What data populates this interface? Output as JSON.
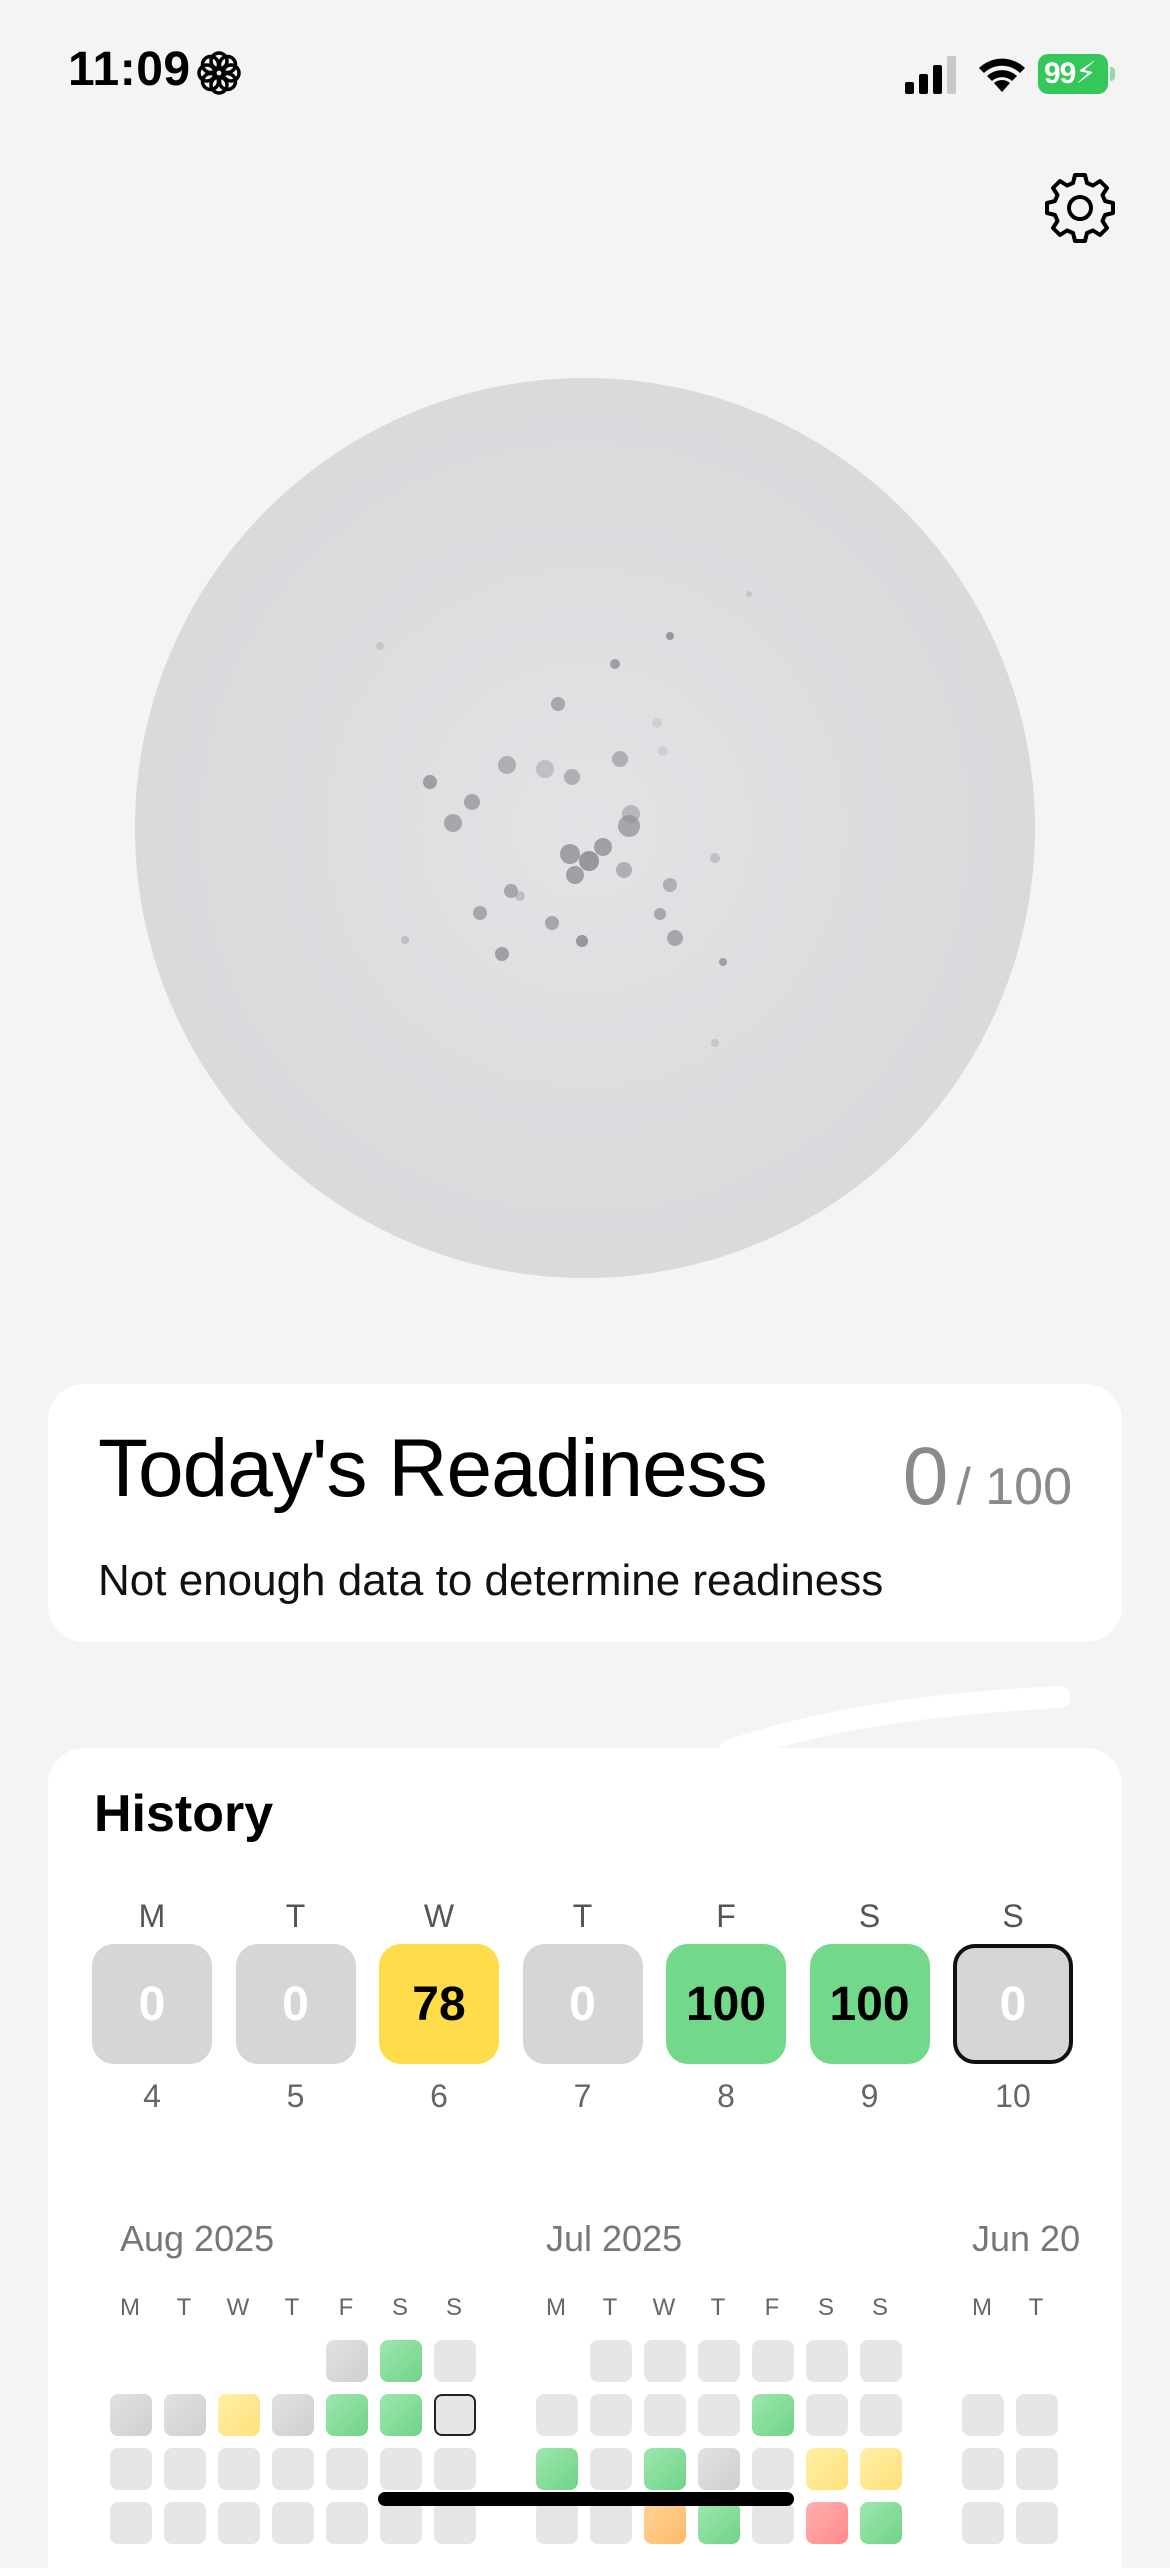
{
  "status_bar": {
    "time": "11:09",
    "battery": "99"
  },
  "readiness": {
    "title": "Today's Readiness",
    "score": "0",
    "max": "/ 100",
    "message": "Not enough data to determine readiness"
  },
  "history": {
    "title": "History",
    "week": [
      {
        "letter": "M",
        "score": "0",
        "day": "4",
        "status": "gray"
      },
      {
        "letter": "T",
        "score": "0",
        "day": "5",
        "status": "gray"
      },
      {
        "letter": "W",
        "score": "78",
        "day": "6",
        "status": "yellow"
      },
      {
        "letter": "T",
        "score": "0",
        "day": "7",
        "status": "gray"
      },
      {
        "letter": "F",
        "score": "100",
        "day": "8",
        "status": "green"
      },
      {
        "letter": "S",
        "score": "100",
        "day": "9",
        "status": "green"
      },
      {
        "letter": "S",
        "score": "0",
        "day": "10",
        "status": "today"
      }
    ],
    "months": [
      {
        "label": "Aug 2025",
        "dow": [
          "M",
          "T",
          "W",
          "T",
          "F",
          "S",
          "S"
        ],
        "rows": [
          [
            "",
            "",
            "",
            "",
            "gray",
            "green",
            "empty"
          ],
          [
            "gray",
            "gray",
            "yellow",
            "gray",
            "green",
            "green",
            "today"
          ],
          [
            "empty",
            "empty",
            "empty",
            "empty",
            "empty",
            "empty",
            "empty"
          ],
          [
            "empty",
            "empty",
            "empty",
            "empty",
            "empty",
            "empty",
            "empty"
          ]
        ]
      },
      {
        "label": "Jul 2025",
        "dow": [
          "M",
          "T",
          "W",
          "T",
          "F",
          "S",
          "S"
        ],
        "rows": [
          [
            "",
            "empty",
            "empty",
            "empty",
            "empty",
            "empty",
            "empty"
          ],
          [
            "empty",
            "empty",
            "empty",
            "empty",
            "green",
            "empty",
            "empty"
          ],
          [
            "green",
            "empty",
            "green",
            "gray",
            "empty",
            "yellow",
            "yellow"
          ],
          [
            "empty",
            "empty",
            "orange",
            "green",
            "empty",
            "red",
            "green"
          ]
        ]
      },
      {
        "label": "Jun 20",
        "dow": [
          "M",
          "T"
        ],
        "rows": [
          [
            "",
            ""
          ],
          [
            "empty",
            "empty"
          ],
          [
            "empty",
            "empty"
          ],
          [
            "empty",
            "empty"
          ]
        ]
      }
    ]
  }
}
